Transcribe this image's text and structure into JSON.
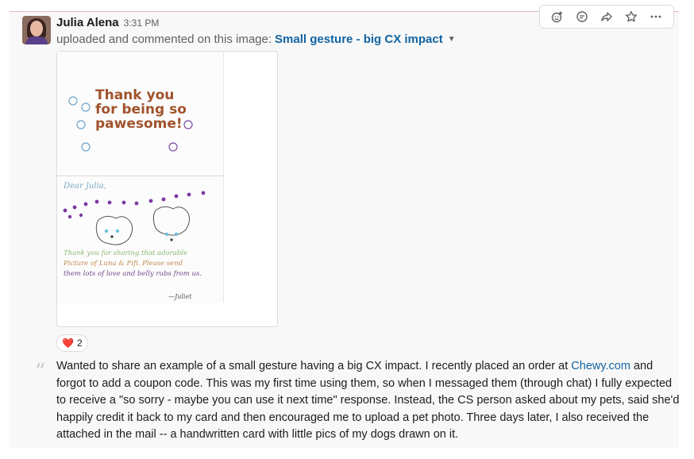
{
  "message": {
    "author": "Julia Alena",
    "time": "3:31 PM",
    "subline_prefix": "uploaded and commented on this image:",
    "file_title": "Small gesture - big CX impact",
    "reaction_emoji": "❤️",
    "reaction_count": "2",
    "body_lines": [
      {
        "before": "Wanted to share an example of a small gesture having a big CX impact.  I recently placed an order at ",
        "link": "Chewy.com",
        "after": " and"
      },
      {
        "before": "forgot to add a coupon code.  This was my first time using them, so when I messaged them (through chat) I fully expected",
        "link": "",
        "after": ""
      },
      {
        "before": "to receive a \"so sorry - maybe you can use it next time\" response.  Instead, the CS person asked about my pets, said she'd",
        "link": "",
        "after": ""
      },
      {
        "before": "happily credit it back to my card and then encouraged me to upload a pet photo.  Three days later, I also received the",
        "link": "",
        "after": ""
      },
      {
        "before": "attached in the mail -- a handwritten card with little pics of my dogs drawn on it.",
        "link": "",
        "after": ""
      }
    ]
  },
  "card": {
    "front_line1": "Thank you",
    "front_line2": "for being so",
    "front_line3": "pawesome!",
    "dear": "Dear  Julia,",
    "hand_line1": "Thank you for sharing that adorable",
    "hand_line2": "Picture of Luna & Fifi. Please send",
    "hand_line3": "them lots of love and belly rubs from us.",
    "signature": "—Juliet"
  },
  "toolbar": {
    "icons": [
      "add-reaction-icon",
      "comment-icon",
      "share-icon",
      "star-icon",
      "more-actions-icon"
    ]
  },
  "colors": {
    "link": "#1264a3",
    "card_text": "#a0532c",
    "muted": "#616061"
  }
}
